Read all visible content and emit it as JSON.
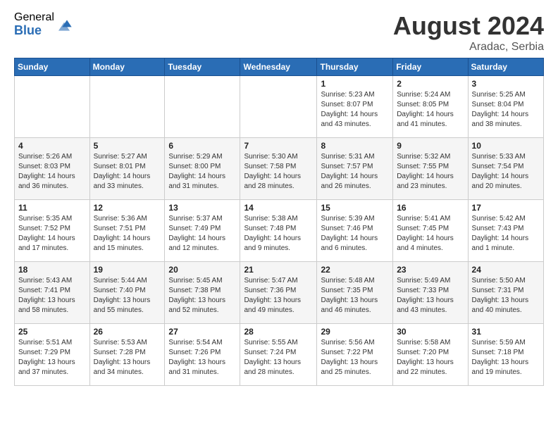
{
  "logo": {
    "general": "General",
    "blue": "Blue"
  },
  "title": "August 2024",
  "location": "Aradac, Serbia",
  "days_of_week": [
    "Sunday",
    "Monday",
    "Tuesday",
    "Wednesday",
    "Thursday",
    "Friday",
    "Saturday"
  ],
  "weeks": [
    [
      {
        "day": "",
        "info": ""
      },
      {
        "day": "",
        "info": ""
      },
      {
        "day": "",
        "info": ""
      },
      {
        "day": "",
        "info": ""
      },
      {
        "day": "1",
        "info": "Sunrise: 5:23 AM\nSunset: 8:07 PM\nDaylight: 14 hours\nand 43 minutes."
      },
      {
        "day": "2",
        "info": "Sunrise: 5:24 AM\nSunset: 8:05 PM\nDaylight: 14 hours\nand 41 minutes."
      },
      {
        "day": "3",
        "info": "Sunrise: 5:25 AM\nSunset: 8:04 PM\nDaylight: 14 hours\nand 38 minutes."
      }
    ],
    [
      {
        "day": "4",
        "info": "Sunrise: 5:26 AM\nSunset: 8:03 PM\nDaylight: 14 hours\nand 36 minutes."
      },
      {
        "day": "5",
        "info": "Sunrise: 5:27 AM\nSunset: 8:01 PM\nDaylight: 14 hours\nand 33 minutes."
      },
      {
        "day": "6",
        "info": "Sunrise: 5:29 AM\nSunset: 8:00 PM\nDaylight: 14 hours\nand 31 minutes."
      },
      {
        "day": "7",
        "info": "Sunrise: 5:30 AM\nSunset: 7:58 PM\nDaylight: 14 hours\nand 28 minutes."
      },
      {
        "day": "8",
        "info": "Sunrise: 5:31 AM\nSunset: 7:57 PM\nDaylight: 14 hours\nand 26 minutes."
      },
      {
        "day": "9",
        "info": "Sunrise: 5:32 AM\nSunset: 7:55 PM\nDaylight: 14 hours\nand 23 minutes."
      },
      {
        "day": "10",
        "info": "Sunrise: 5:33 AM\nSunset: 7:54 PM\nDaylight: 14 hours\nand 20 minutes."
      }
    ],
    [
      {
        "day": "11",
        "info": "Sunrise: 5:35 AM\nSunset: 7:52 PM\nDaylight: 14 hours\nand 17 minutes."
      },
      {
        "day": "12",
        "info": "Sunrise: 5:36 AM\nSunset: 7:51 PM\nDaylight: 14 hours\nand 15 minutes."
      },
      {
        "day": "13",
        "info": "Sunrise: 5:37 AM\nSunset: 7:49 PM\nDaylight: 14 hours\nand 12 minutes."
      },
      {
        "day": "14",
        "info": "Sunrise: 5:38 AM\nSunset: 7:48 PM\nDaylight: 14 hours\nand 9 minutes."
      },
      {
        "day": "15",
        "info": "Sunrise: 5:39 AM\nSunset: 7:46 PM\nDaylight: 14 hours\nand 6 minutes."
      },
      {
        "day": "16",
        "info": "Sunrise: 5:41 AM\nSunset: 7:45 PM\nDaylight: 14 hours\nand 4 minutes."
      },
      {
        "day": "17",
        "info": "Sunrise: 5:42 AM\nSunset: 7:43 PM\nDaylight: 14 hours\nand 1 minute."
      }
    ],
    [
      {
        "day": "18",
        "info": "Sunrise: 5:43 AM\nSunset: 7:41 PM\nDaylight: 13 hours\nand 58 minutes."
      },
      {
        "day": "19",
        "info": "Sunrise: 5:44 AM\nSunset: 7:40 PM\nDaylight: 13 hours\nand 55 minutes."
      },
      {
        "day": "20",
        "info": "Sunrise: 5:45 AM\nSunset: 7:38 PM\nDaylight: 13 hours\nand 52 minutes."
      },
      {
        "day": "21",
        "info": "Sunrise: 5:47 AM\nSunset: 7:36 PM\nDaylight: 13 hours\nand 49 minutes."
      },
      {
        "day": "22",
        "info": "Sunrise: 5:48 AM\nSunset: 7:35 PM\nDaylight: 13 hours\nand 46 minutes."
      },
      {
        "day": "23",
        "info": "Sunrise: 5:49 AM\nSunset: 7:33 PM\nDaylight: 13 hours\nand 43 minutes."
      },
      {
        "day": "24",
        "info": "Sunrise: 5:50 AM\nSunset: 7:31 PM\nDaylight: 13 hours\nand 40 minutes."
      }
    ],
    [
      {
        "day": "25",
        "info": "Sunrise: 5:51 AM\nSunset: 7:29 PM\nDaylight: 13 hours\nand 37 minutes."
      },
      {
        "day": "26",
        "info": "Sunrise: 5:53 AM\nSunset: 7:28 PM\nDaylight: 13 hours\nand 34 minutes."
      },
      {
        "day": "27",
        "info": "Sunrise: 5:54 AM\nSunset: 7:26 PM\nDaylight: 13 hours\nand 31 minutes."
      },
      {
        "day": "28",
        "info": "Sunrise: 5:55 AM\nSunset: 7:24 PM\nDaylight: 13 hours\nand 28 minutes."
      },
      {
        "day": "29",
        "info": "Sunrise: 5:56 AM\nSunset: 7:22 PM\nDaylight: 13 hours\nand 25 minutes."
      },
      {
        "day": "30",
        "info": "Sunrise: 5:58 AM\nSunset: 7:20 PM\nDaylight: 13 hours\nand 22 minutes."
      },
      {
        "day": "31",
        "info": "Sunrise: 5:59 AM\nSunset: 7:18 PM\nDaylight: 13 hours\nand 19 minutes."
      }
    ]
  ]
}
